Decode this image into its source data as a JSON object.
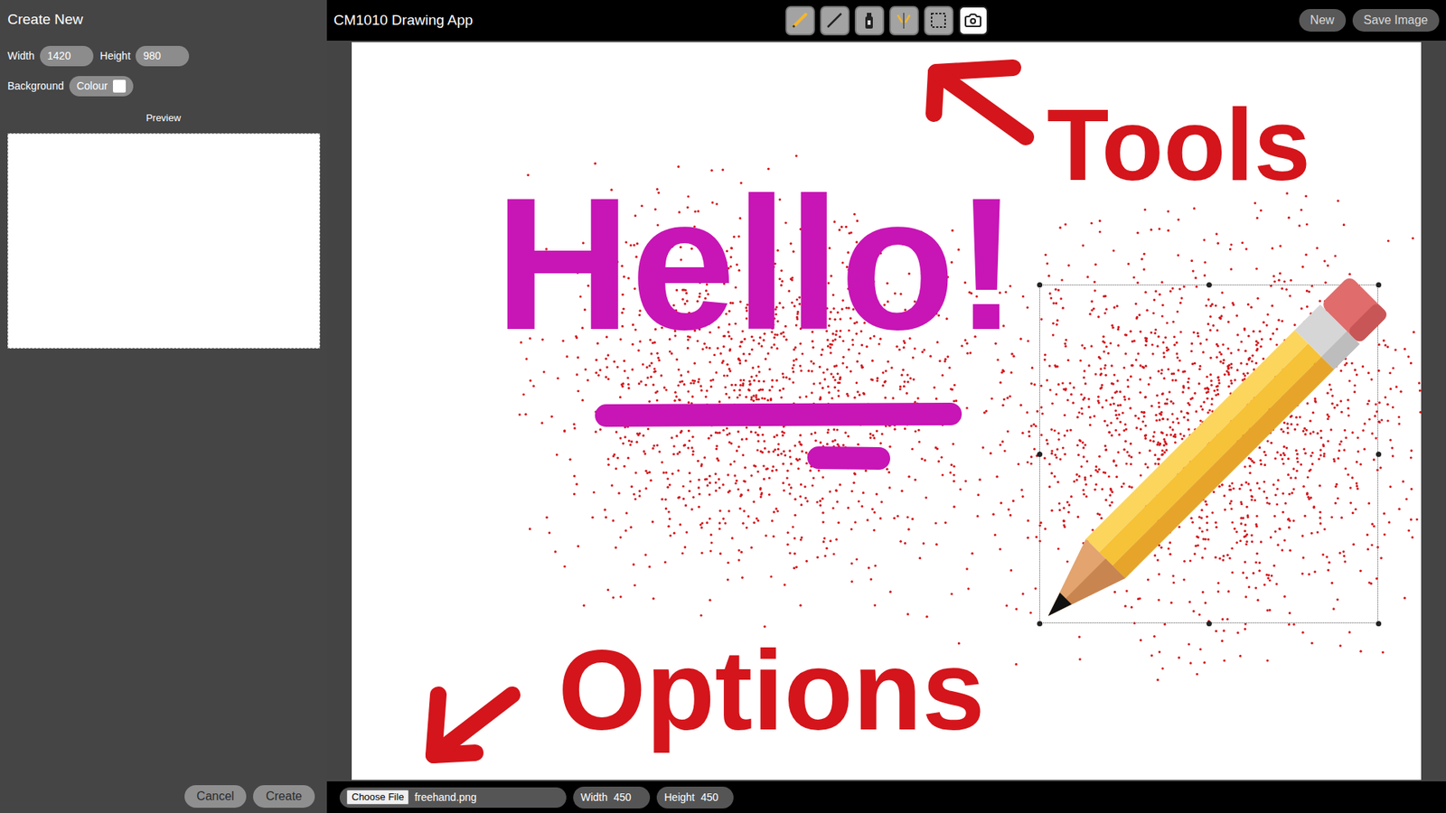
{
  "window": {
    "title": "CM1010 Drawing App"
  },
  "toolbar": {
    "tools": [
      {
        "kind": "freehand",
        "selected": false
      },
      {
        "kind": "line",
        "selected": false
      },
      {
        "kind": "spray",
        "selected": false
      },
      {
        "kind": "mirror",
        "selected": false
      },
      {
        "kind": "select",
        "selected": false
      },
      {
        "kind": "stamp",
        "selected": true
      }
    ],
    "buttons": [
      "New",
      "Save Image"
    ]
  },
  "sidebar": {
    "title": "Create New",
    "fields": [
      {
        "label": "Width",
        "value": "1420"
      },
      {
        "label": "Height",
        "value": "980"
      }
    ],
    "background": {
      "label": "Background",
      "button": "Colour",
      "color": "#ffffff"
    },
    "preview_label": "Preview",
    "buttons": [
      "Cancel",
      "Create"
    ]
  },
  "canvas": {
    "strokes": [
      {
        "text": "Hello!",
        "color": "#c815b5"
      },
      {
        "text": "Tools",
        "color": "#d4151b"
      },
      {
        "text": "Options",
        "color": "#d4151b"
      }
    ],
    "spray_color": "#d4151b"
  },
  "options_bar": {
    "file_button": "Choose File",
    "file_name": "freehand.png",
    "fields": [
      {
        "label": "Width",
        "value": "450"
      },
      {
        "label": "Height",
        "value": "450"
      }
    ]
  }
}
